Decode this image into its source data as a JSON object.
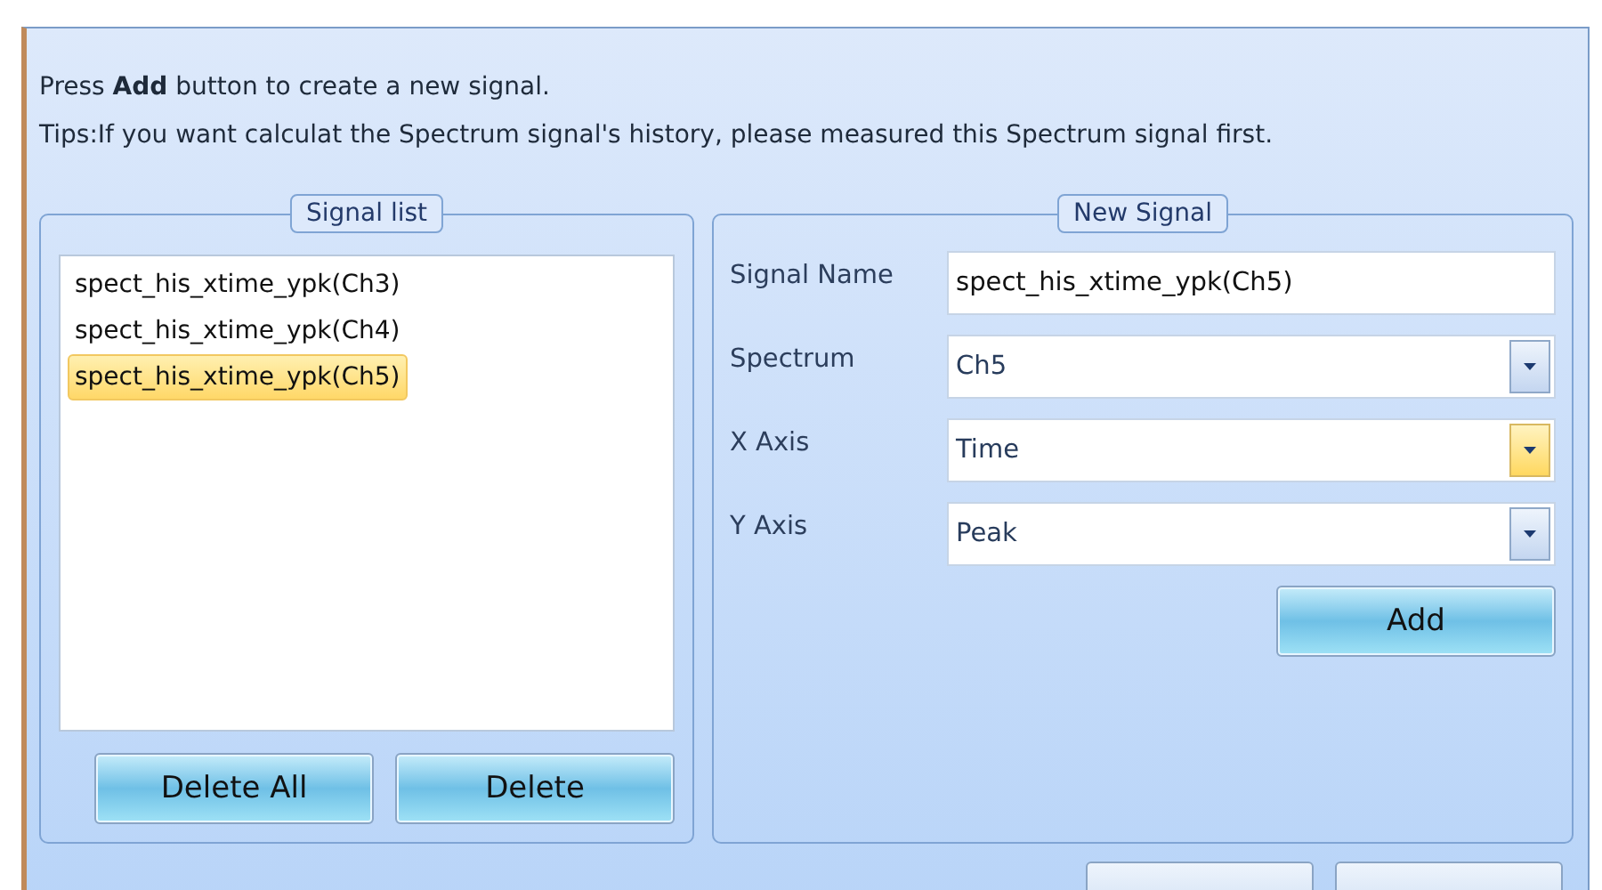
{
  "intro": {
    "line1": "Press **Add** button to create a new signal.",
    "line2": "Tips:If you want calculat the Spectrum signal's history, please measured this Spectrum signal first."
  },
  "signal_list": {
    "title": "Signal list",
    "items": [
      {
        "label": "spect_his_xtime_ypk(Ch3)",
        "selected": false
      },
      {
        "label": "spect_his_xtime_ypk(Ch4)",
        "selected": false
      },
      {
        "label": "spect_his_xtime_ypk(Ch5)",
        "selected": true
      }
    ],
    "buttons": [
      "Delete All",
      "Delete"
    ]
  },
  "new_signal": {
    "title": "New Signal",
    "fields": [
      {
        "kind": "text",
        "label": "Signal Name",
        "value": "spect_his_xtime_ypk(Ch5)"
      },
      {
        "kind": "combo",
        "label": "Spectrum",
        "value": "Ch5",
        "hovered": false
      },
      {
        "kind": "combo",
        "label": "X Axis",
        "value": "Time",
        "hovered": true
      },
      {
        "kind": "combo",
        "label": "Y Axis",
        "value": "Peak",
        "hovered": false
      }
    ],
    "button": "Add"
  },
  "footer_buttons": [
    {
      "kind": "cut"
    },
    {
      "kind": "cut"
    }
  ]
}
